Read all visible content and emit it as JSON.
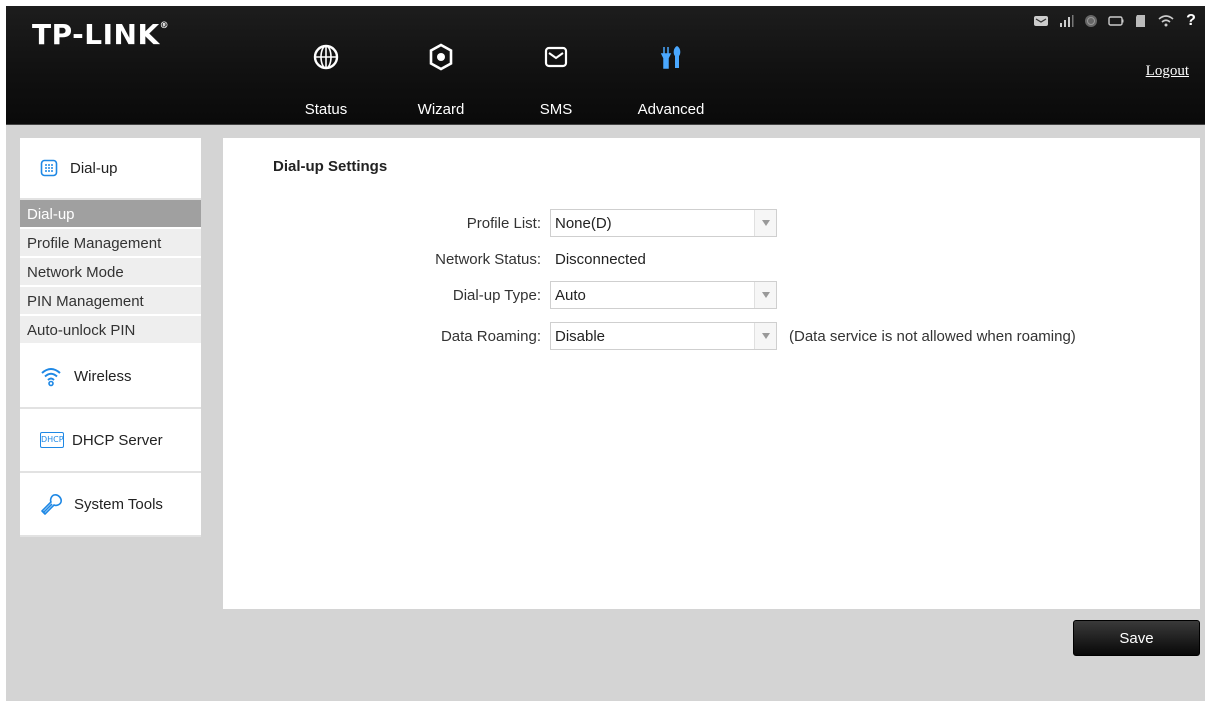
{
  "brand": {
    "logo": "TP-LINK",
    "mark": "®"
  },
  "header": {
    "nav": [
      {
        "label": "Status",
        "icon": "globe-icon"
      },
      {
        "label": "Wizard",
        "icon": "gear-icon"
      },
      {
        "label": "SMS",
        "icon": "envelope-icon"
      },
      {
        "label": "Advanced",
        "icon": "tools-icon"
      }
    ],
    "logout": "Logout",
    "status_icons": [
      "sms-icon",
      "signal-icon",
      "internet-icon",
      "battery-icon",
      "sd-card-icon",
      "wifi-icon",
      "help-icon"
    ]
  },
  "sidebar": {
    "dialup_group": "Dial-up",
    "dialup_items": [
      "Dial-up",
      "Profile Management",
      "Network Mode",
      "PIN Management",
      "Auto-unlock PIN"
    ],
    "wireless": "Wireless",
    "dhcp": "DHCP Server",
    "dhcp_icon_text": "DHCP",
    "system_tools": "System Tools"
  },
  "main": {
    "title": "Dial-up Settings",
    "profile_list": {
      "label": "Profile List:",
      "value": "None(D)"
    },
    "network_status": {
      "label": "Network Status:",
      "value": "Disconnected"
    },
    "dialup_type": {
      "label": "Dial-up Type:",
      "value": "Auto"
    },
    "data_roaming": {
      "label": "Data Roaming:",
      "value": "Disable",
      "note": "(Data service is not allowed when roaming)"
    }
  },
  "save_label": "Save",
  "colors": {
    "header": "#111111",
    "accent_blue": "#1e88e5",
    "background": "#d4d4d4",
    "active_item": "#a0a0a0"
  }
}
